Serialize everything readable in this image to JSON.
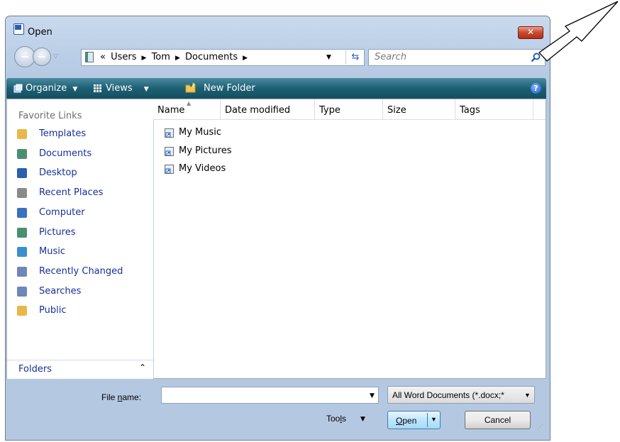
{
  "window": {
    "title": "Open",
    "close_glyph": "✕",
    "icon": "word-document-icon"
  },
  "nav": {
    "back_icon": "back-arrow-icon",
    "forward_icon": "forward-arrow-icon",
    "dropdown_glyph": "▽"
  },
  "address": {
    "prefix": "«",
    "crumbs": [
      "Users",
      "Tom",
      "Documents"
    ],
    "sep": "▶",
    "dropdown_glyph": "▼",
    "refresh_glyph": "⇆"
  },
  "search": {
    "placeholder": "Search",
    "icon": "search-icon"
  },
  "toolbar": {
    "organize": "Organize",
    "views": "Views",
    "new_folder": "New Folder",
    "dropdown_glyph": "▼",
    "help_glyph": "?"
  },
  "sidebar": {
    "title": "Favorite Links",
    "items": [
      {
        "label": "Templates",
        "icon": "folder-icon",
        "color": "#e8b84a"
      },
      {
        "label": "Documents",
        "icon": "documents-icon",
        "color": "#4b8f73"
      },
      {
        "label": "Desktop",
        "icon": "desktop-icon",
        "color": "#2b5fae"
      },
      {
        "label": "Recent Places",
        "icon": "recent-places-icon",
        "color": "#8a8a8a"
      },
      {
        "label": "Computer",
        "icon": "computer-icon",
        "color": "#3b6fc0"
      },
      {
        "label": "Pictures",
        "icon": "pictures-icon",
        "color": "#4b8f73"
      },
      {
        "label": "Music",
        "icon": "music-icon",
        "color": "#3b8fd0"
      },
      {
        "label": "Recently Changed",
        "icon": "recently-changed-icon",
        "color": "#6f86b8"
      },
      {
        "label": "Searches",
        "icon": "searches-icon",
        "color": "#6f86b8"
      },
      {
        "label": "Public",
        "icon": "folder-icon",
        "color": "#e8b84a"
      }
    ],
    "folders_label": "Folders",
    "folders_chevron": "⌃"
  },
  "columns": [
    "Name",
    "Date modified",
    "Type",
    "Size",
    "Tags"
  ],
  "sort_glyph": "▲",
  "files": [
    {
      "label": "My Music",
      "icon": "shortcut-icon"
    },
    {
      "label": "My Pictures",
      "icon": "shortcut-icon"
    },
    {
      "label": "My Videos",
      "icon": "shortcut-icon"
    }
  ],
  "bottom": {
    "filename_label_pre": "File ",
    "filename_label_ul": "n",
    "filename_label_post": "ame:",
    "filename_value": "",
    "filename_dropdown": "▼",
    "filetype_value": "All Word Documents (*.docx;*",
    "filetype_dropdown": "▼",
    "tools_pre": "Too",
    "tools_ul": "l",
    "tools_post": "s",
    "tools_dropdown": "▼",
    "open_ul": "O",
    "open_post": "pen",
    "open_dropdown": "▼",
    "cancel": "Cancel",
    "grip": "⋰"
  }
}
